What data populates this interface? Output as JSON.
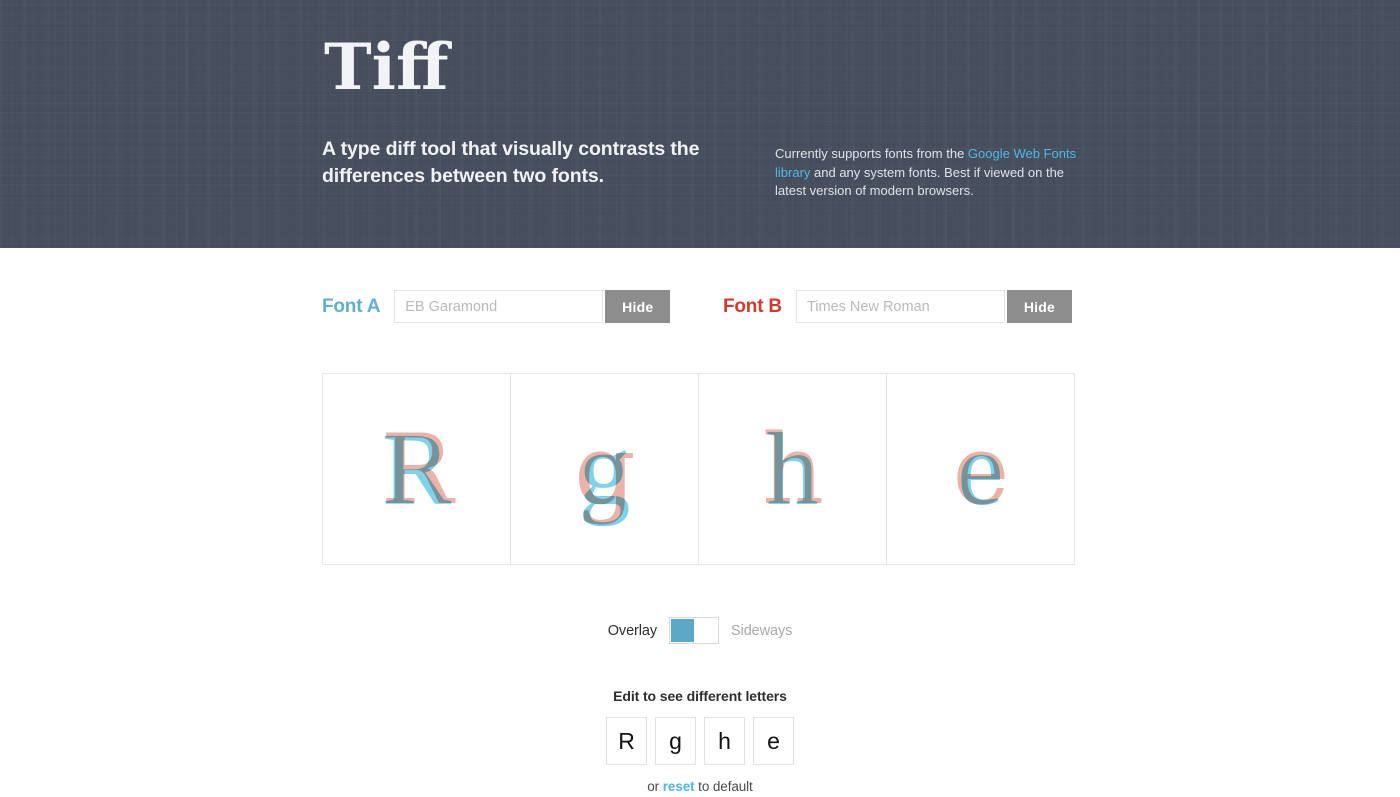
{
  "header": {
    "title": "Tiff",
    "tagline": "A type diff tool that visually contrasts the differences between two fonts.",
    "support_note": {
      "part1": "Currently supports fonts from the ",
      "link": "Google Web Fonts library",
      "part2": " and any system fonts. Best if viewed on the latest version of modern browsers."
    },
    "background_color": "#474f5e",
    "link_color": "#4db8e8"
  },
  "controls": {
    "font_a": {
      "label": "Font A",
      "label_color": "#63b0cd",
      "input_value": "",
      "placeholder": "EB Garamond",
      "hide_label": "Hide"
    },
    "font_b": {
      "label": "Font B",
      "label_color": "#d03b2f",
      "input_value": "",
      "placeholder": "Times New Roman",
      "hide_label": "Hide"
    }
  },
  "comparison": {
    "mode": "Overlay",
    "glyphs": [
      {
        "char": "R"
      },
      {
        "char": "g"
      },
      {
        "char": "h"
      },
      {
        "char": "e"
      }
    ],
    "font_a_color": "#63c8e8",
    "font_b_color": "#e79f91"
  },
  "view_toggle": {
    "left_label": "Overlay",
    "right_label": "Sideways",
    "active": "Overlay",
    "accent_color": "#5aa9c9"
  },
  "editor": {
    "title": "Edit to see different letters",
    "letters": [
      "R",
      "g",
      "h",
      "e"
    ],
    "reset_prefix": "or ",
    "reset_link": "reset",
    "reset_suffix": " to default"
  }
}
